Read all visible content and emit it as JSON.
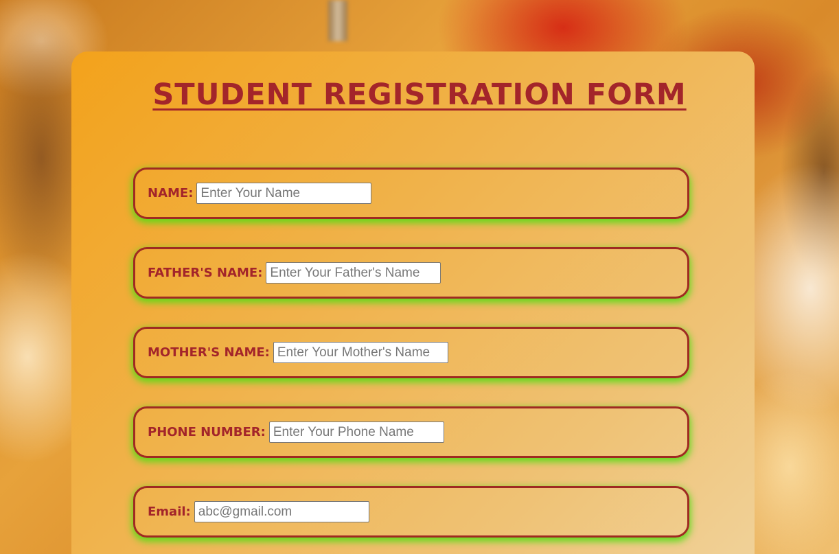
{
  "form": {
    "title": "STUDENT REGISTRATION FORM",
    "fields": [
      {
        "label": "NAME:",
        "placeholder": "Enter Your Name",
        "value": ""
      },
      {
        "label": "FATHER'S NAME:",
        "placeholder": "Enter Your Father's Name",
        "value": ""
      },
      {
        "label": "MOTHER'S NAME:",
        "placeholder": "Enter Your Mother's Name",
        "value": ""
      },
      {
        "label": "PHONE NUMBER:",
        "placeholder": "Enter Your Phone Name",
        "value": ""
      },
      {
        "label": "Email:",
        "placeholder": "abc@gmail.com",
        "value": ""
      }
    ]
  },
  "colors": {
    "accent": "#a3252a",
    "row_glow": "#56dc14",
    "card_start": "#f3a21b",
    "card_end": "#f0d29a"
  }
}
